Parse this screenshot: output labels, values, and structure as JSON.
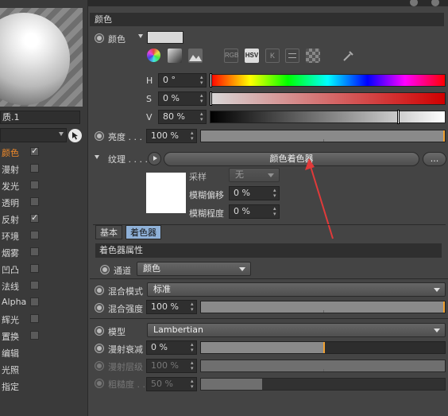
{
  "left": {
    "material_name": "质.1",
    "channels": [
      {
        "label": "颜色",
        "checked": true,
        "active": true
      },
      {
        "label": "漫射",
        "checked": false
      },
      {
        "label": "发光",
        "checked": false
      },
      {
        "label": "透明",
        "checked": false
      },
      {
        "label": "反射",
        "checked": true
      },
      {
        "label": "环境",
        "checked": false
      },
      {
        "label": "烟雾",
        "checked": false
      },
      {
        "label": "凹凸",
        "checked": false
      },
      {
        "label": "法线",
        "checked": false
      },
      {
        "label": "Alpha",
        "checked": false
      },
      {
        "label": "辉光",
        "checked": false
      },
      {
        "label": "置换",
        "checked": false
      },
      {
        "label": "编辑",
        "checked": null
      },
      {
        "label": "光照",
        "checked": null
      },
      {
        "label": "指定",
        "checked": null
      }
    ]
  },
  "color_section": {
    "title": "颜色",
    "color_label": "颜色",
    "swatch_color": "#d8d8d8",
    "mode_buttons": [
      "RGB",
      "HSV",
      "K"
    ],
    "h_label": "H",
    "h_value": "0 °",
    "h_marker": 0.0,
    "s_label": "S",
    "s_value": "0 %",
    "s_marker": 0.0,
    "v_label": "V",
    "v_value": "80 %",
    "v_marker": 0.8,
    "brightness_label": "亮度 . . .",
    "brightness_value": "100 %",
    "brightness_fill": 1.0
  },
  "texture": {
    "label": "纹理 . . . .",
    "shader_button": "颜色着色器",
    "more_button": "...",
    "sampling_label": "采样",
    "sampling_value": "无",
    "blur_offset_label": "模糊偏移",
    "blur_offset_value": "0 %",
    "blur_scale_label": "模糊程度",
    "blur_scale_value": "0 %"
  },
  "tabs": [
    "基本",
    "着色器"
  ],
  "shader_props": {
    "header": "着色器属性",
    "channel_label": "通道",
    "channel_value": "颜色"
  },
  "mix": {
    "mode_label": "混合模式",
    "mode_value": "标准",
    "strength_label": "混合强度",
    "strength_value": "100 %",
    "strength_fill": 1.0
  },
  "model": {
    "model_label": "模型",
    "model_value": "Lambertian",
    "falloff_label": "漫射衰减",
    "falloff_value": "0 %",
    "falloff_fill": 0.5,
    "level_label": "漫射层级",
    "level_value": "100 %",
    "level_fill": 1.0,
    "rough_label": "粗糙度 . .",
    "rough_value": "50 %",
    "rough_fill": 0.25
  }
}
